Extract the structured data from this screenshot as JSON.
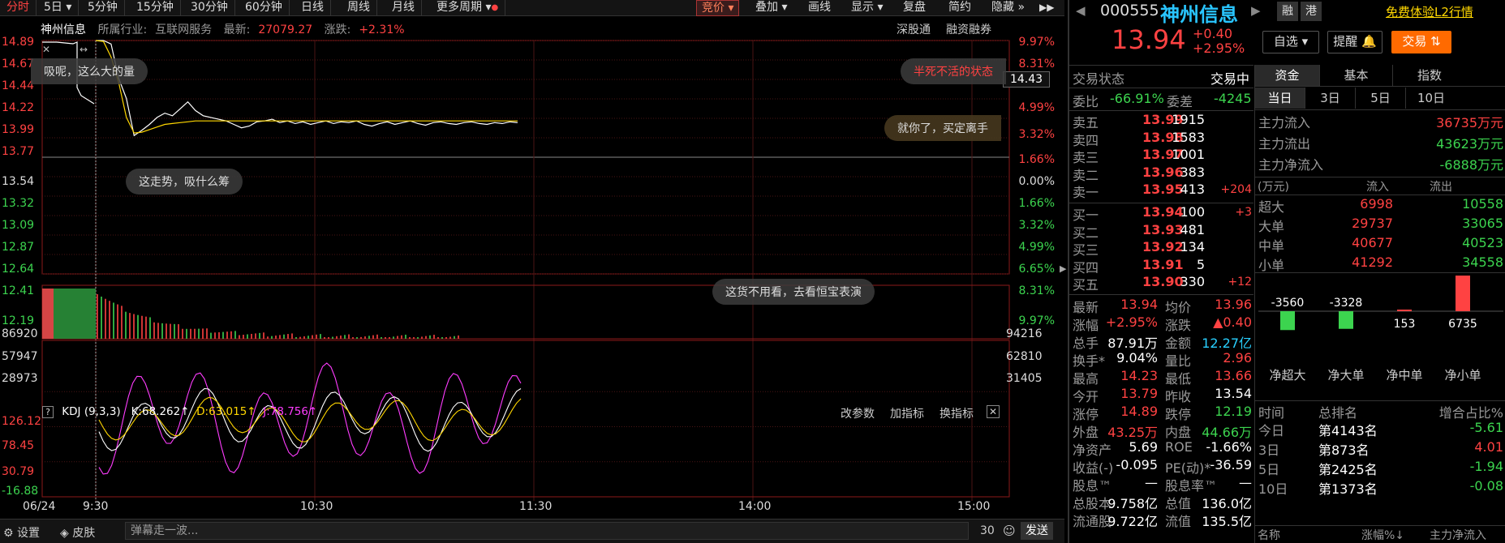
{
  "toolbar": {
    "items": [
      "分时",
      "5日",
      "5分钟",
      "15分钟",
      "30分钟",
      "60分钟",
      "日线",
      "周线",
      "月线",
      "更多周期"
    ],
    "right": [
      "竞价",
      "叠加",
      "画线",
      "显示",
      "复盘",
      "简约",
      "隐藏"
    ]
  },
  "stock_info": {
    "name": "神州信息",
    "industry_label": "所属行业:",
    "industry": "互联网服务",
    "latest_label": "最新:",
    "latest": "27079.27",
    "change_label": "涨跌:",
    "change": "+2.31%",
    "links": [
      "深股通",
      "融资融券"
    ]
  },
  "price_axis": {
    "left": [
      "14.89",
      "14.67",
      "14.44",
      "14.22",
      "13.99",
      "13.77",
      "13.54",
      "13.32",
      "13.09",
      "12.87",
      "12.64",
      "12.41",
      "12.19"
    ],
    "right": [
      "9.97%",
      "8.31%",
      "6.65%",
      "4.99%",
      "3.32%",
      "1.66%",
      "0.00%",
      "1.66%",
      "3.32%",
      "4.99%",
      "6.65%",
      "8.31%",
      "9.97%"
    ],
    "cursor_value": "14.43"
  },
  "volume_axis": {
    "left": [
      "86920",
      "57947",
      "28973"
    ],
    "right": [
      "94216",
      "62810",
      "31405"
    ]
  },
  "kdj": {
    "name": "KDJ (9,3,3)",
    "k": "K:68.262↑",
    "d": "D:63.015↑",
    "j": "J:78.756↑",
    "actions": [
      "改参数",
      "加指标",
      "换指标"
    ],
    "axis": [
      "126.12",
      "78.45",
      "30.79",
      "-16.88"
    ]
  },
  "time_axis": [
    "06/24",
    "9:30",
    "10:30",
    "11:30",
    "14:00",
    "15:00"
  ],
  "bubbles": [
    "吸呢，这么大的量",
    "这走势，吸什么筹",
    "这货不用看，去看恒宝表演",
    "半死不活的状态",
    "就你了，买定离手"
  ],
  "bottom": {
    "settings": "设置",
    "skin": "皮肤",
    "danmaku_placeholder": "弹幕走一波...",
    "count": "30",
    "send": "发送"
  },
  "quote": {
    "code": "000555",
    "name": "神州信息",
    "tags": [
      "融",
      "港"
    ],
    "l2_link": "免费体验L2行情",
    "price": "13.94",
    "change": "+0.40",
    "change_pct": "+2.95%",
    "watch_btn": "自选",
    "remind_btn": "提醒",
    "trade_btn": "交易"
  },
  "status": {
    "label": "交易状态",
    "value": "交易中"
  },
  "weibi": {
    "label": "委比",
    "value": "-66.91%",
    "label2": "委差",
    "value2": "-4245"
  },
  "asks": [
    {
      "label": "卖五",
      "price": "13.99",
      "vol": "1915",
      "chg": ""
    },
    {
      "label": "卖四",
      "price": "13.98",
      "vol": "1583",
      "chg": ""
    },
    {
      "label": "卖三",
      "price": "13.97",
      "vol": "1001",
      "chg": ""
    },
    {
      "label": "卖二",
      "price": "13.96",
      "vol": "383",
      "chg": ""
    },
    {
      "label": "卖一",
      "price": "13.95",
      "vol": "413",
      "chg": "+204"
    }
  ],
  "bids": [
    {
      "label": "买一",
      "price": "13.94",
      "vol": "100",
      "chg": "+3"
    },
    {
      "label": "买二",
      "price": "13.93",
      "vol": "481",
      "chg": ""
    },
    {
      "label": "买三",
      "price": "13.92",
      "vol": "134",
      "chg": ""
    },
    {
      "label": "买四",
      "price": "13.91",
      "vol": "5",
      "chg": ""
    },
    {
      "label": "买五",
      "price": "13.90",
      "vol": "330",
      "chg": "+12"
    }
  ],
  "stats": [
    {
      "l1": "最新",
      "v1": "13.94",
      "c1": "red",
      "l2": "均价",
      "v2": "13.96",
      "c2": "red"
    },
    {
      "l1": "涨幅",
      "v1": "+2.95%",
      "c1": "red",
      "l2": "涨跌",
      "v2": "▲0.40",
      "c2": "red"
    },
    {
      "l1": "总手",
      "v1": "87.91万",
      "c1": "white",
      "l2": "金额",
      "v2": "12.27亿",
      "c2": "cyan"
    },
    {
      "l1": "换手*",
      "v1": "9.04%",
      "c1": "white",
      "l2": "量比",
      "v2": "2.96",
      "c2": "red"
    },
    {
      "l1": "最高",
      "v1": "14.23",
      "c1": "red",
      "l2": "最低",
      "v2": "13.66",
      "c2": "red"
    },
    {
      "l1": "今开",
      "v1": "13.79",
      "c1": "red",
      "l2": "昨收",
      "v2": "13.54",
      "c2": "white"
    },
    {
      "l1": "涨停",
      "v1": "14.89",
      "c1": "red",
      "l2": "跌停",
      "v2": "12.19",
      "c2": "green"
    },
    {
      "l1": "外盘",
      "v1": "43.25万",
      "c1": "red",
      "l2": "内盘",
      "v2": "44.66万",
      "c2": "green"
    },
    {
      "l1": "净资产",
      "v1": "5.69",
      "c1": "white",
      "l2": "ROE",
      "v2": "-1.66%",
      "c2": "white"
    },
    {
      "l1": "收益(-)",
      "v1": "-0.095",
      "c1": "white",
      "l2": "PE(动)*",
      "v2": "-36.59",
      "c2": "white"
    },
    {
      "l1": "股息™",
      "v1": "—",
      "c1": "white",
      "l2": "股息率™",
      "v2": "—",
      "c2": "white"
    },
    {
      "l1": "总股本",
      "v1": "9.758亿",
      "c1": "white",
      "l2": "总值",
      "v2": "136.0亿",
      "c2": "white"
    },
    {
      "l1": "流通股",
      "v1": "9.722亿",
      "c1": "white",
      "l2": "流值",
      "v2": "135.5亿",
      "c2": "white"
    }
  ],
  "fund": {
    "tabs": [
      "资金",
      "基本",
      "指数"
    ],
    "periods": [
      "当日",
      "3日",
      "5日",
      "10日"
    ],
    "rows": [
      {
        "label": "主力流入",
        "value": "36735万元",
        "color": "red"
      },
      {
        "label": "主力流出",
        "value": "43623万元",
        "color": "green"
      },
      {
        "label": "主力净流入",
        "value": "-6888万元",
        "color": "green"
      }
    ],
    "head": {
      "unit": "(万元)",
      "in": "流入",
      "out": "流出"
    },
    "table": [
      {
        "label": "超大",
        "in": "6998",
        "out": "10558"
      },
      {
        "label": "大单",
        "in": "29737",
        "out": "33065"
      },
      {
        "label": "中单",
        "in": "40677",
        "out": "40523"
      },
      {
        "label": "小单",
        "in": "41292",
        "out": "34558"
      }
    ],
    "bar_labels": [
      "净超大",
      "净大单",
      "净中单",
      "净小单"
    ],
    "bar_values": [
      "-3560",
      "-3328",
      "153",
      "6735"
    ],
    "rank_head": [
      "时间",
      "总排名",
      "增合占比%"
    ],
    "ranks": [
      {
        "t": "今日",
        "r": "第4143名",
        "p": "-5.61",
        "c": "green"
      },
      {
        "t": "3日",
        "r": "第873名",
        "p": "4.01",
        "c": "red"
      },
      {
        "t": "5日",
        "r": "第2425名",
        "p": "-1.94",
        "c": "green"
      },
      {
        "t": "10日",
        "r": "第1373名",
        "p": "-0.08",
        "c": "green"
      }
    ],
    "list_head": [
      "名称",
      "涨幅%↓",
      "主力净流入"
    ]
  },
  "chart_data": {
    "type": "line",
    "x": [
      "9:30",
      "10:30",
      "11:30"
    ],
    "prev_close": 13.54,
    "ylim": [
      12.19,
      14.89
    ],
    "series": [
      {
        "values": [
          14.89,
          14.89,
          14.85,
          14.45,
          14.22,
          13.79,
          13.85,
          13.92,
          14.0,
          14.05,
          14.02,
          14.1,
          14.18,
          14.08,
          14.02,
          14.0,
          13.98,
          13.96,
          13.92,
          13.88,
          13.9,
          13.95,
          13.96,
          13.98,
          13.94,
          13.96,
          13.93,
          13.95,
          13.92,
          13.94,
          13.96,
          13.93,
          13.95,
          13.94,
          13.96,
          13.92,
          13.9,
          13.93,
          13.95,
          13.92,
          13.94,
          13.96,
          13.93,
          13.91,
          13.94,
          13.95,
          13.93,
          13.92,
          13.94,
          13.95,
          13.93,
          13.92,
          13.94,
          13.93,
          13.95,
          13.94
        ]
      },
      {
        "values": [
          14.89,
          14.88,
          14.7,
          14.4,
          14.0,
          13.82,
          13.83,
          13.86,
          13.89,
          13.92,
          13.93,
          13.94,
          13.95,
          13.96,
          13.96,
          13.96,
          13.96,
          13.96,
          13.96,
          13.96,
          13.96,
          13.96,
          13.96,
          13.96,
          13.96,
          13.96,
          13.96,
          13.96,
          13.96,
          13.96,
          13.96,
          13.96,
          13.96,
          13.96,
          13.96,
          13.96,
          13.96,
          13.96,
          13.96,
          13.96,
          13.96,
          13.96,
          13.96,
          13.96,
          13.96,
          13.96,
          13.96,
          13.96,
          13.96,
          13.96,
          13.96,
          13.96,
          13.96,
          13.96,
          13.96,
          13.96
        ]
      }
    ]
  }
}
